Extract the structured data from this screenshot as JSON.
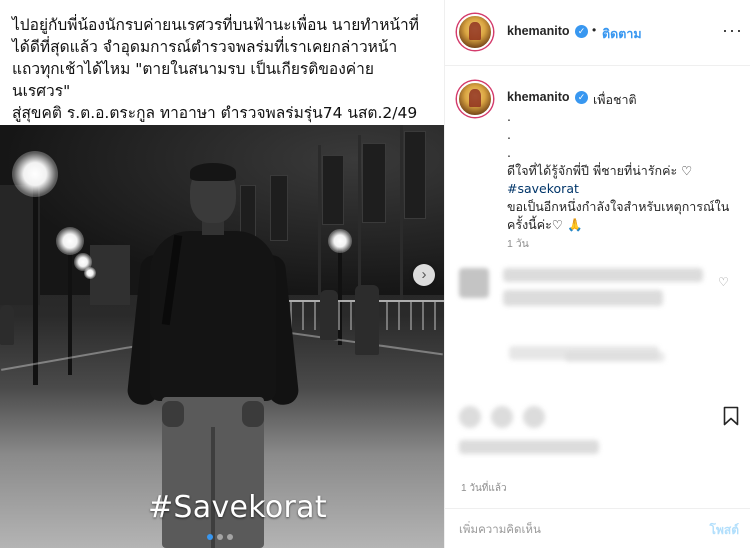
{
  "post_media": {
    "overlay_lines": [
      "ไปอยู่กับพี่น้องนักรบค่ายนเรศวรที่บนฟ้านะเพื่อน นายทำหน้าที่",
      "ได้ดีที่สุดแล้ว  จำอุดมการณ์ตำรวจพลร่มที่เราเคยกล่าวหน้า",
      "แถวทุกเช้าได้ไหม \"ตายในสนามรบ เป็นเกียรติของค่าย",
      "นเรศวร\"",
      "สู่สุขคติ ร.ต.อ.ตระกูล ทาอาษา  ตำรวจพลร่มรุ่น74  นสต.2/49"
    ],
    "hashtag_overlay": "#Savekorat",
    "next_glyph": "›",
    "carousel_dots": 3,
    "carousel_active_index": 0
  },
  "header": {
    "username": "khemanito",
    "verified_glyph": "✓",
    "separator": "•",
    "follow_label": "ติดตาม",
    "more_glyph": "···"
  },
  "caption": {
    "username": "khemanito",
    "first_line": "เพื่อชาติ",
    "lines": [
      ".",
      ".",
      ".",
      "ดีใจที่ได้รู้จักพี่ปี  พี่ชายที่น่ารักค่ะ ♡"
    ],
    "hashtag": "#savekorat",
    "closing": "ขอเป็นอีกหนึ่งกำลังใจสำหรับเหตุการณ์ในครั้งนี้ค่ะ♡ 🙏",
    "time": "1 วัน"
  },
  "actions": {
    "bookmark_icon": "bookmark-icon",
    "heart_glyph": "♡"
  },
  "post_date": "1 วันที่แล้ว",
  "comment_bar": {
    "placeholder": "เพิ่มความคิดเห็น",
    "post_label": "โพสต์"
  },
  "colors": {
    "accent": "#3897f0",
    "post_disabled": "#b2dffc"
  }
}
